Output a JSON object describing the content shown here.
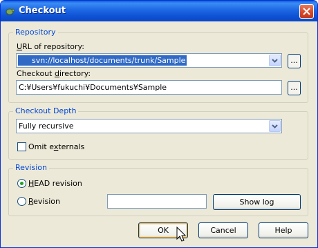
{
  "window": {
    "title": "Checkout"
  },
  "repository": {
    "group_label": "Repository",
    "url_label_u": "U",
    "url_label_rest": "RL of repository:",
    "url_value": "svn://localhost/documents/trunk/Sample",
    "browse_label": "...",
    "dir_label_pre": "Checkout ",
    "dir_label_u": "d",
    "dir_label_rest": "irectory:",
    "dir_value": "C:¥Users¥fukuchi¥Documents¥Sample",
    "dir_browse_label": "..."
  },
  "depth": {
    "group_label": "Checkout Depth",
    "selected": "Fully recursive",
    "omit_pre": "Omit e",
    "omit_u": "x",
    "omit_rest": "ternals",
    "omit_checked": false
  },
  "revision": {
    "group_label": "Revision",
    "head_u": "H",
    "head_rest": "EAD revision",
    "head_selected": true,
    "rev_u": "R",
    "rev_rest": "evision",
    "rev_value": "",
    "show_log_label": "Show log"
  },
  "buttons": {
    "ok": "OK",
    "cancel": "Cancel",
    "help": "Help"
  },
  "colors": {
    "titlebar": "#0a5fd8",
    "group_title": "#0046d5",
    "selection": "#316ac5",
    "dialog_bg": "#ece9d8"
  }
}
